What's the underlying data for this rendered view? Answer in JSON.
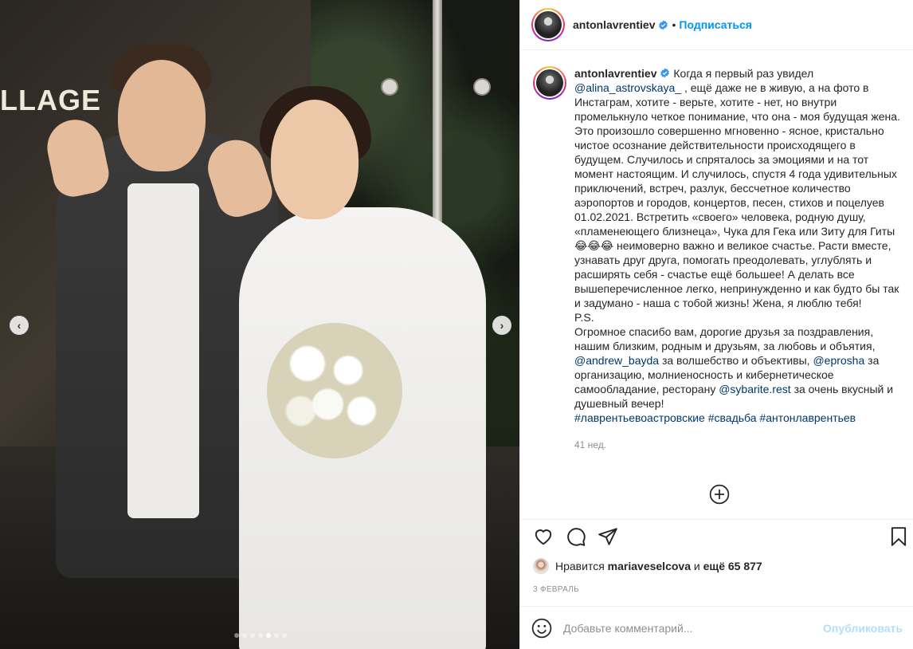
{
  "photo": {
    "sign_text": "LLAGE",
    "nav_prev": "‹",
    "nav_next": "›",
    "dots_count": 7,
    "active_dot": 5
  },
  "post": {
    "username": "antonlavrentiev",
    "separator": "•",
    "follow_label": "Подписаться",
    "caption_segments": [
      {
        "t": "text",
        "v": " Когда я первый раз увидел "
      },
      {
        "t": "link",
        "v": "@alina_astrovskaya_"
      },
      {
        "t": "text",
        "v": " , ещё даже не в живую, а на фото в Инстаграм, хотите - верьте, хотите - нет, но внутри промелькнуло четкое понимание, что она - моя будущая жена. Это произошло совершенно мгновенно - ясное, кристально чистое осознание действительности происходящего в будущем. Случилось и спряталось за эмоциями и на тот момент настоящим. И случилось, спустя 4 года удивительных приключений, встреч, разлук, бессчетное количество аэропортов и городов, концертов, песен, стихов и поцелуев 01.02.2021. Встретить «своего» человека, родную душу, «пламенеющего близнеца», Чука для Гека или Зиту для Гиты 😂😂😂 неимоверно важно и великое счастье. Расти вместе, узнавать друг друга, помогать преодолевать, углублять и расширять себя - счастье ещё большее! А делать все вышеперечисленное легко, непринужденно и как будто бы так и задумано - наша с тобой жизнь! Жена, я люблю тебя!\nP.S.\nОгромное спасибо вам, дорогие друзья за поздравления, нашим близким, родным и друзьям, за любовь и объятия, "
      },
      {
        "t": "link",
        "v": "@andrew_bayda"
      },
      {
        "t": "text",
        "v": " за волшебство и объективы, "
      },
      {
        "t": "link",
        "v": "@eprosha"
      },
      {
        "t": "text",
        "v": " за организацию, молниеносность и кибернетическое самообладание, ресторану "
      },
      {
        "t": "link",
        "v": "@sybarite.rest"
      },
      {
        "t": "text",
        "v": " за очень вкусный и душевный вечер!\n"
      },
      {
        "t": "link",
        "v": "#лаврентьевоастровские"
      },
      {
        "t": "text",
        "v": " "
      },
      {
        "t": "link",
        "v": "#свадьба"
      },
      {
        "t": "text",
        "v": " "
      },
      {
        "t": "link",
        "v": "#антонлаврентьев"
      }
    ],
    "time_ago": "41 нед.",
    "likes_prefix": "Нравится ",
    "likes_user": "mariaveselcova",
    "likes_middle": " и ",
    "likes_rest": "ещё 65 877",
    "date": "3 ФЕВРАЛЬ",
    "comment_placeholder": "Добавьте комментарий...",
    "publish_label": "Опубликовать"
  },
  "colors": {
    "link": "#00376b",
    "follow": "#0095f6",
    "publish_disabled": "#b2dffc",
    "muted": "#8e8e8e"
  },
  "icons": [
    "verified-badge-icon",
    "plus-circle-icon",
    "heart-icon",
    "comment-icon",
    "share-icon",
    "bookmark-icon",
    "emoji-icon"
  ]
}
